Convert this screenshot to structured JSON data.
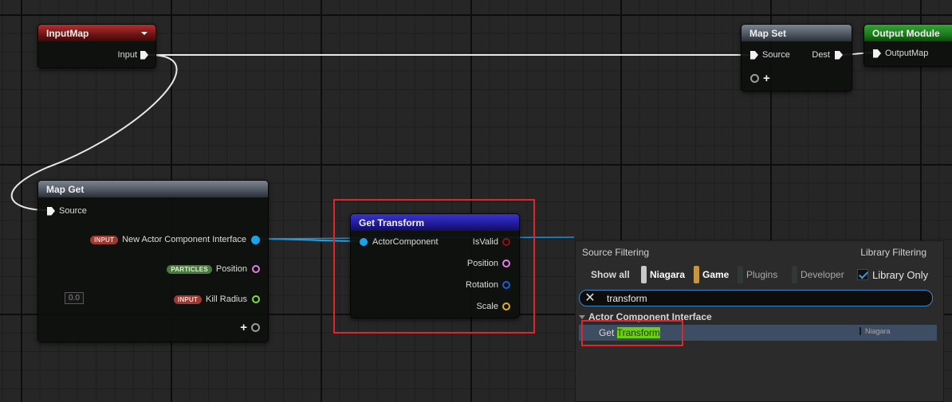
{
  "nodes": {
    "input_map": {
      "title": "InputMap",
      "pins": {
        "input": "Input"
      }
    },
    "map_set": {
      "title": "Map Set",
      "pins": {
        "source": "Source",
        "dest": "Dest"
      }
    },
    "output_module": {
      "title": "Output Module",
      "pins": {
        "output_map": "OutputMap"
      }
    },
    "map_get": {
      "title": "Map Get",
      "pins": {
        "source": "Source",
        "actor_component": {
          "badge": "INPUT",
          "label": "New Actor Component Interface"
        },
        "position": {
          "badge": "PARTICLES",
          "label": "Position"
        },
        "kill_radius": {
          "badge": "INPUT",
          "label": "Kill Radius",
          "value": "0.0"
        }
      }
    },
    "get_transform": {
      "title": "Get Transform",
      "pins": {
        "actor_component": "ActorComponent",
        "is_valid": "IsValid",
        "position": "Position",
        "rotation": "Rotation",
        "scale": "Scale"
      }
    }
  },
  "search_panel": {
    "source_filtering_label": "Source Filtering",
    "library_filtering_label": "Library Filtering",
    "filters": {
      "show_all": "Show all",
      "niagara": "Niagara",
      "game": "Game",
      "plugins": "Plugins",
      "developer": "Developer"
    },
    "library_only": {
      "label": "Library Only",
      "checked": true
    },
    "search": {
      "value": "transform",
      "placeholder": ""
    },
    "category": "Actor Component Interface",
    "result": {
      "prefix": "Get ",
      "match": "Transform",
      "source": "Niagara"
    }
  },
  "colors": {
    "exec_pin": "#f2f2f2",
    "object_pin": "#1aa3e8",
    "bool_pin": "#8a1414",
    "vector_pin": "#e080e0",
    "rotation_pin": "#1a5fd0",
    "scale_pin": "#e0b020",
    "float_pin": "#7fe03a",
    "highlight": "#e0262a",
    "search_match": "#6ad10f"
  }
}
